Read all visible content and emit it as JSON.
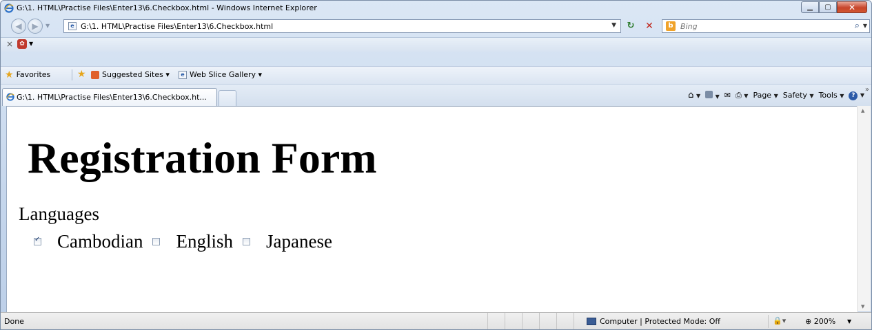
{
  "window": {
    "title": "G:\\1. HTML\\Practise Files\\Enter13\\6.Checkbox.html - Windows Internet Explorer"
  },
  "address": {
    "url": "G:\\1. HTML\\Practise Files\\Enter13\\6.Checkbox.html"
  },
  "search": {
    "placeholder": "Bing"
  },
  "favorites": {
    "label": "Favorites",
    "items": [
      {
        "label": "Suggested Sites ▾"
      },
      {
        "label": "Web Slice Gallery ▾"
      }
    ]
  },
  "tabs": [
    {
      "label": "G:\\1. HTML\\Practise Files\\Enter13\\6.Checkbox.ht..."
    }
  ],
  "commandbar": {
    "page": "Page",
    "safety": "Safety",
    "tools": "Tools"
  },
  "page": {
    "heading": "Registration Form",
    "languages_label": "Languages",
    "options": [
      {
        "label": "Cambodian",
        "checked": true
      },
      {
        "label": "English",
        "checked": false
      },
      {
        "label": "Japanese",
        "checked": false
      }
    ]
  },
  "status": {
    "text": "Done",
    "zone": "Computer | Protected Mode: Off",
    "zoom": "200%"
  },
  "colors": {
    "frame": "#c5d6ec",
    "close_button": "#c7442b"
  },
  "icons": [
    "ie-logo-icon",
    "back-icon",
    "forward-icon",
    "refresh-icon",
    "stop-icon",
    "bing-icon",
    "search-icon",
    "star-icon",
    "home-icon",
    "feeds-icon",
    "mail-icon",
    "print-icon",
    "help-icon",
    "zoom-icon"
  ]
}
